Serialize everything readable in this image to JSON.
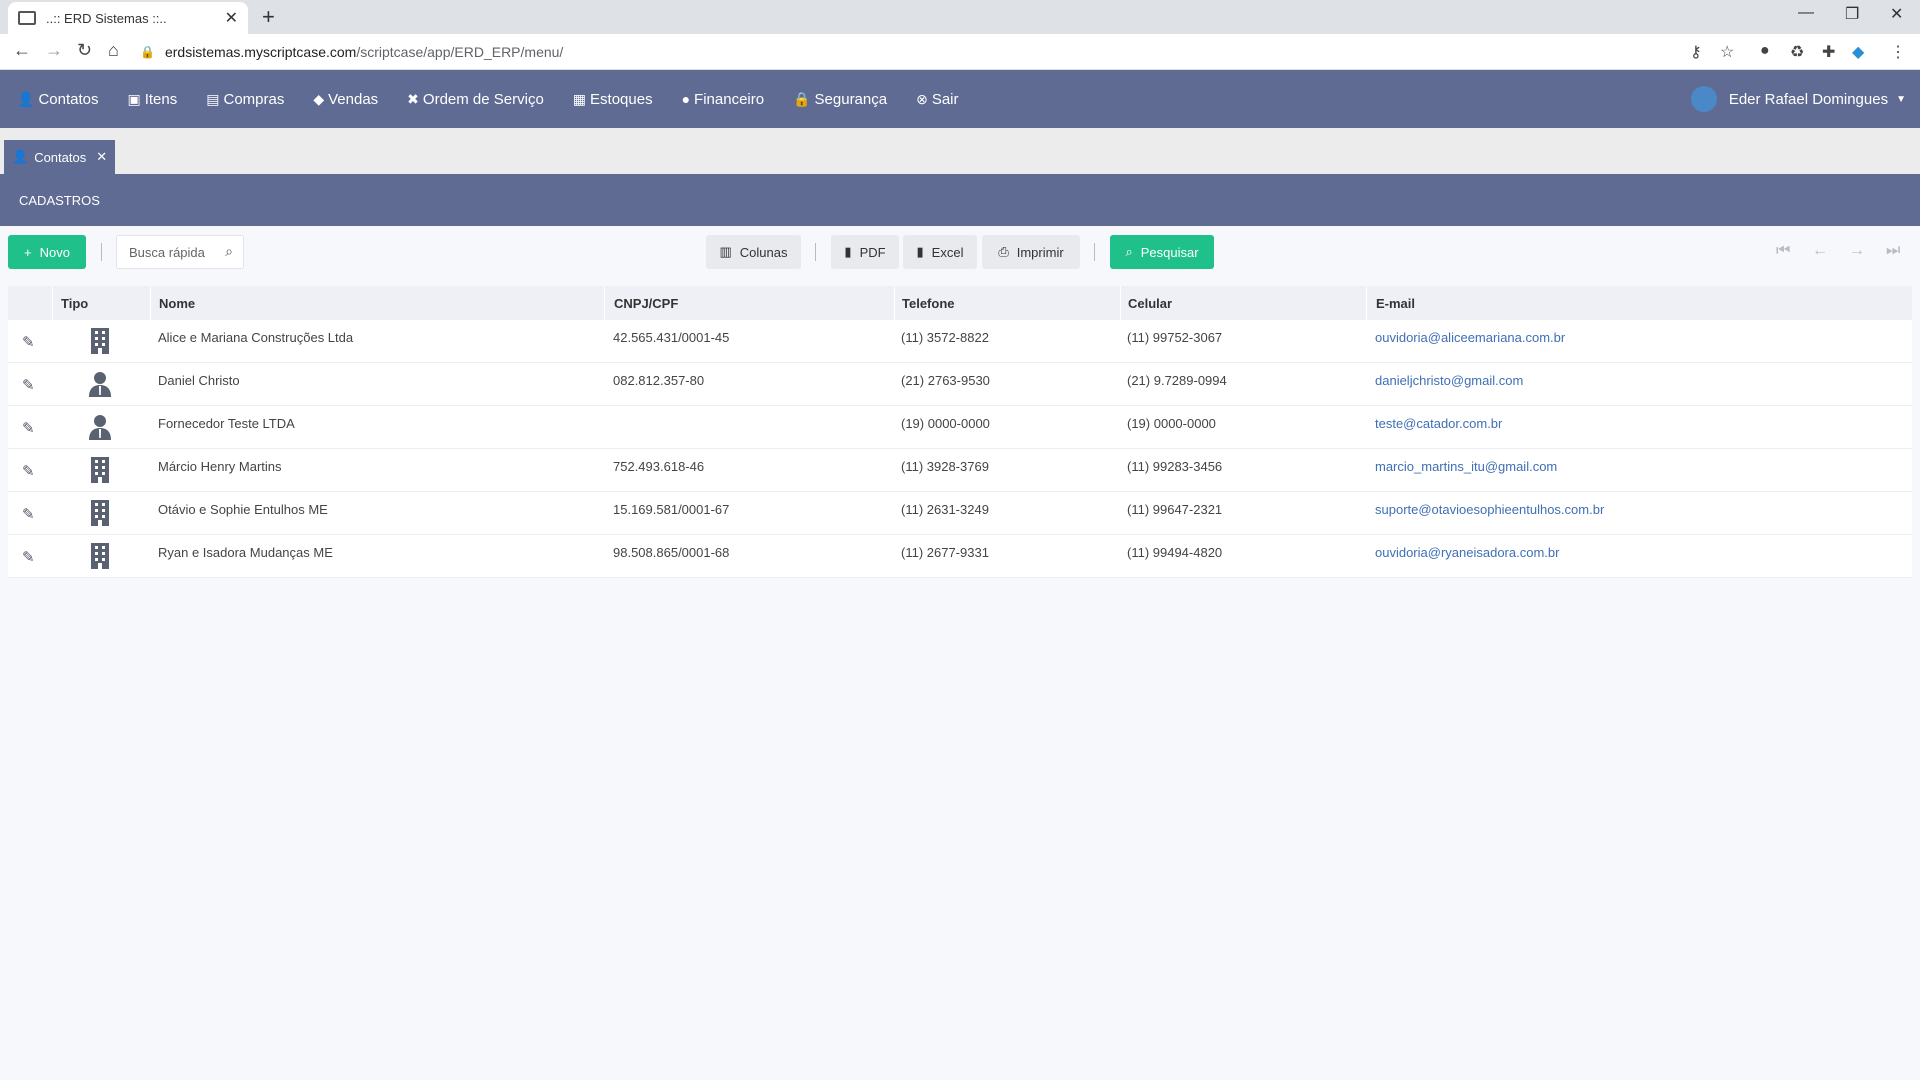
{
  "browser": {
    "tab_title": "..:: ERD Sistemas ::..",
    "url_host": "erdsistemas.myscriptcase.com",
    "url_path": "/scriptcase/app/ERD_ERP/menu/"
  },
  "menu": {
    "items": [
      {
        "label": "Contatos",
        "icon": "user-icon"
      },
      {
        "label": "Itens",
        "icon": "boxes-icon"
      },
      {
        "label": "Compras",
        "icon": "shopping-bag-icon"
      },
      {
        "label": "Vendas",
        "icon": "tags-icon"
      },
      {
        "label": "Ordem de Serviço",
        "icon": "tools-icon"
      },
      {
        "label": "Estoques",
        "icon": "warehouse-icon"
      },
      {
        "label": "Financeiro",
        "icon": "money-icon"
      },
      {
        "label": "Segurança",
        "icon": "lock-icon"
      },
      {
        "label": "Sair",
        "icon": "close-circle-icon"
      }
    ],
    "user_name": "Eder Rafael Domingues"
  },
  "app_tab": {
    "label": "Contatos"
  },
  "section_title": "CADASTROS",
  "toolbar": {
    "novo": "Novo",
    "search_placeholder": "Busca rápida",
    "colunas": "Colunas",
    "pdf": "PDF",
    "excel": "Excel",
    "imprimir": "Imprimir",
    "pesquisar": "Pesquisar"
  },
  "table": {
    "headers": {
      "tipo": "Tipo",
      "nome": "Nome",
      "cnpj": "CNPJ/CPF",
      "telefone": "Telefone",
      "celular": "Celular",
      "email": "E-mail"
    },
    "rows": [
      {
        "tipo": "building-icon",
        "nome": "Alice e Mariana Construções Ltda",
        "cnpj": "42.565.431/0001-45",
        "telefone": "(11) 3572-8822",
        "celular": "(11) 99752-3067",
        "email": "ouvidoria@aliceemariana.com.br"
      },
      {
        "tipo": "person-icon",
        "nome": "Daniel Christo",
        "cnpj": "082.812.357-80",
        "telefone": "(21) 2763-9530",
        "celular": "(21) 9.7289-0994",
        "email": "danieljchristo@gmail.com"
      },
      {
        "tipo": "person-icon",
        "nome": "Fornecedor Teste LTDA",
        "cnpj": "",
        "telefone": "(19) 0000-0000",
        "celular": "(19) 0000-0000",
        "email": "teste@catador.com.br"
      },
      {
        "tipo": "building-icon",
        "nome": "Márcio Henry Martins",
        "cnpj": "752.493.618-46",
        "telefone": "(11) 3928-3769",
        "celular": "(11) 99283-3456",
        "email": "marcio_martins_itu@gmail.com"
      },
      {
        "tipo": "building-icon",
        "nome": "Otávio e Sophie Entulhos ME",
        "cnpj": "15.169.581/0001-67",
        "telefone": "(11) 2631-3249",
        "celular": "(11) 99647-2321",
        "email": "suporte@otavioesophieentulhos.com.br"
      },
      {
        "tipo": "building-icon",
        "nome": "Ryan e Isadora Mudanças ME",
        "cnpj": "98.508.865/0001-68",
        "telefone": "(11) 2677-9331",
        "celular": "(11) 99494-4820",
        "email": "ouvidoria@ryaneisadora.com.br"
      }
    ]
  }
}
